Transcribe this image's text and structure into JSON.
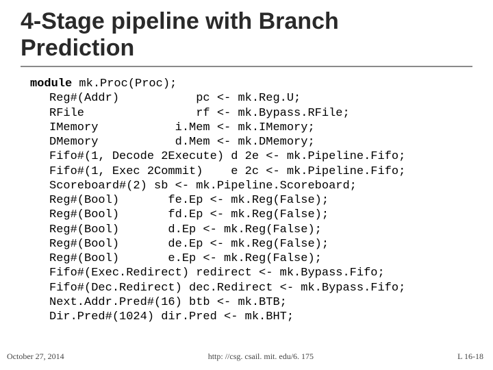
{
  "title_line1": "4-Stage pipeline with Branch",
  "title_line2": "Prediction",
  "code": {
    "kw": "module",
    "l0_rest": " mk.Proc(Proc);",
    "lines": [
      "Reg#(Addr)           pc <- mk.Reg.U;",
      "RFile                rf <- mk.Bypass.RFile;",
      "IMemory           i.Mem <- mk.IMemory;",
      "DMemory           d.Mem <- mk.DMemory;",
      "Fifo#(1, Decode 2Execute) d 2e <- mk.Pipeline.Fifo;",
      "Fifo#(1, Exec 2Commit)    e 2c <- mk.Pipeline.Fifo;",
      "Scoreboard#(2) sb <- mk.Pipeline.Scoreboard;",
      "Reg#(Bool)       fe.Ep <- mk.Reg(False);",
      "Reg#(Bool)       fd.Ep <- mk.Reg(False);",
      "Reg#(Bool)       d.Ep <- mk.Reg(False);",
      "Reg#(Bool)       de.Ep <- mk.Reg(False);",
      "Reg#(Bool)       e.Ep <- mk.Reg(False);",
      "Fifo#(Exec.Redirect) redirect <- mk.Bypass.Fifo;",
      "Fifo#(Dec.Redirect) dec.Redirect <- mk.Bypass.Fifo;",
      "Next.Addr.Pred#(16) btb <- mk.BTB;",
      "Dir.Pred#(1024) dir.Pred <- mk.BHT;"
    ]
  },
  "footer": {
    "date": "October 27, 2014",
    "url": "http: //csg. csail. mit. edu/6. 175",
    "page": "L 16-18"
  }
}
